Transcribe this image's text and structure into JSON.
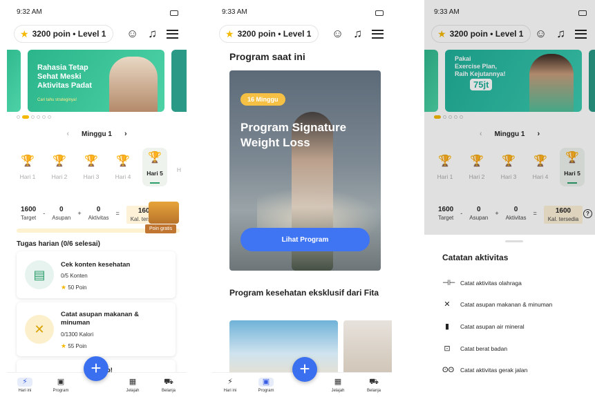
{
  "screen1": {
    "time": "9:32 AM",
    "points_pill": "3200 poin • Level 1",
    "banner": {
      "title_line1": "Rahasia Tetap",
      "title_line2": "Sehat Meski",
      "title_line3": "Aktivitas Padat",
      "cta": "Cari tahu strateginya!"
    },
    "week_label": "Minggu 1",
    "days": [
      "Hari 1",
      "Hari 2",
      "Hari 3",
      "Hari 4",
      "Hari 5",
      "H"
    ],
    "calories": {
      "target_value": "1600",
      "target_label": "Target",
      "intake_value": "0",
      "intake_label": "Asupan",
      "activity_value": "0",
      "activity_label": "Aktivitas",
      "available_value": "1600",
      "available_label": "Kal. tersedia"
    },
    "poin_gratis": "Poin gratis",
    "tasks_title": "Tugas harian (0/6 selesai)",
    "tasks": [
      {
        "title": "Cek konten kesehatan",
        "progress": "0/5 Konten",
        "points": "50 Poin"
      },
      {
        "title": "Catat asupan makanan & minuman",
        "progress": "0/1300 Kalori",
        "points": "55 Poin"
      }
    ],
    "peek_text": "o!"
  },
  "screen2": {
    "time": "9:33 AM",
    "points_pill": "3200 poin • Level 1",
    "section_title": "Program saat ini",
    "program_badge": "16 Minggu",
    "program_name": "Program Signature Weight Loss",
    "program_button": "Lihat Program",
    "section_title2": "Program kesehatan eksklusif dari Fita"
  },
  "screen3": {
    "time": "9:33 AM",
    "points_pill": "3200 poin • Level 1",
    "banner": {
      "line1": "Pakai",
      "line2": "Exercise Plan,",
      "line3": "Raih Kejutannya!",
      "amount": "75jt"
    },
    "week_label": "Minggu 1",
    "days": [
      "Hari 1",
      "Hari 2",
      "Hari 3",
      "Hari 4",
      "Hari 5"
    ],
    "calories": {
      "target_value": "1600",
      "target_label": "Target",
      "intake_value": "0",
      "intake_label": "Asupan",
      "activity_value": "0",
      "activity_label": "Aktivitas",
      "available_value": "1600",
      "available_label": "Kal. tersedia"
    },
    "help": "?",
    "sheet_title": "Catatan aktivitas",
    "sheet_options": [
      {
        "icon": "dumbbell-icon",
        "label": "Catat aktivitas olahraga"
      },
      {
        "icon": "utensils-icon",
        "label": "Catat asupan makanan & minuman"
      },
      {
        "icon": "glass-icon",
        "label": "Catat asupan air mineral"
      },
      {
        "icon": "scale-icon",
        "label": "Catat berat badan"
      },
      {
        "icon": "footsteps-icon",
        "label": "Catat aktivitas gerak jalan"
      }
    ]
  },
  "nav": [
    "Hari ini",
    "Program",
    "",
    "Jelajah",
    "Belanja"
  ],
  "ops": {
    "minus": "-",
    "plus": "+",
    "equals": "="
  },
  "colors": {
    "accent_blue": "#3a6ff0",
    "star": "#f5b800",
    "green_banner": "#2bb58a",
    "gold": "#f5c043"
  }
}
